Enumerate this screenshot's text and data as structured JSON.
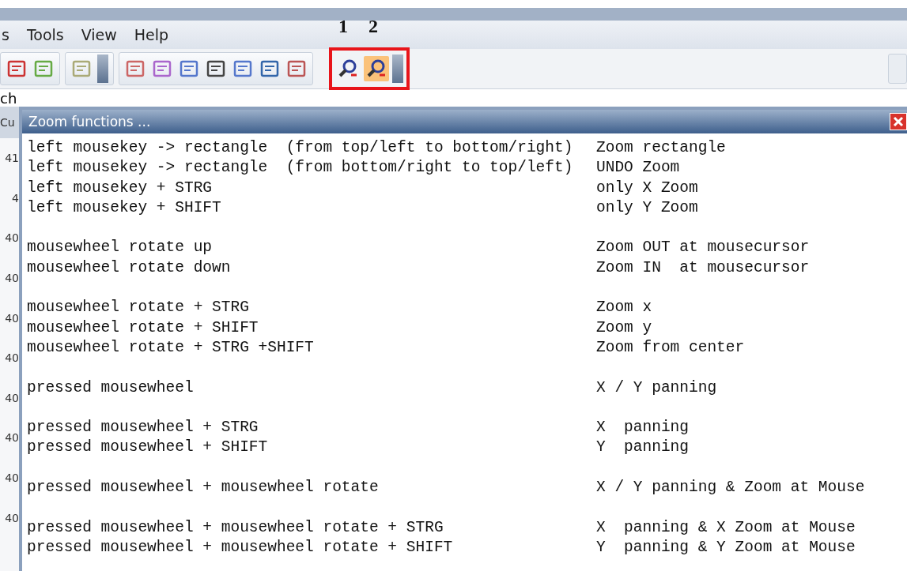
{
  "menu_bar": {
    "items": [
      "s",
      "Tools",
      "View",
      "Help"
    ]
  },
  "toolbar": {
    "zoom_buttons": [
      {
        "annotation": "1",
        "selected": false
      },
      {
        "annotation": "2",
        "selected": true
      }
    ]
  },
  "background": {
    "field_text": "ch",
    "left_column": [
      "Cu",
      "41",
      "4",
      "40",
      "40",
      "40",
      "40",
      "40",
      "40",
      "40",
      "40"
    ]
  },
  "dialog": {
    "title": "Zoom functions ...",
    "groups": [
      [
        {
          "action": "left mousekey -> rectangle  (from top/left to bottom/right)",
          "result": "Zoom rectangle"
        },
        {
          "action": "left mousekey -> rectangle  (from bottom/right to top/left)",
          "result": "UNDO Zoom"
        },
        {
          "action": "left mousekey + STRG",
          "result": "only X Zoom"
        },
        {
          "action": "left mousekey + SHIFT",
          "result": "only Y Zoom"
        }
      ],
      [
        {
          "action": "mousewheel rotate up",
          "result": "Zoom OUT at mousecursor"
        },
        {
          "action": "mousewheel rotate down",
          "result": "Zoom IN  at mousecursor"
        }
      ],
      [
        {
          "action": "mousewheel rotate + STRG",
          "result": "Zoom x"
        },
        {
          "action": "mousewheel rotate + SHIFT",
          "result": "Zoom y"
        },
        {
          "action": "mousewheel rotate + STRG +SHIFT",
          "result": "Zoom from center"
        }
      ],
      [
        {
          "action": "pressed mousewheel",
          "result": "X / Y panning"
        }
      ],
      [
        {
          "action": "pressed mousewheel + STRG",
          "result": "X  panning"
        },
        {
          "action": "pressed mousewheel + SHIFT",
          "result": "Y  panning"
        }
      ],
      [
        {
          "action": "pressed mousewheel + mousewheel rotate",
          "result": "X / Y panning & Zoom at Mouse"
        }
      ],
      [
        {
          "action": "pressed mousewheel + mousewheel rotate + STRG",
          "result": "X  panning & X Zoom at Mouse"
        },
        {
          "action": "pressed mousewheel + mousewheel rotate + SHIFT",
          "result": "Y  panning & Y Zoom at Mouse"
        }
      ]
    ]
  }
}
